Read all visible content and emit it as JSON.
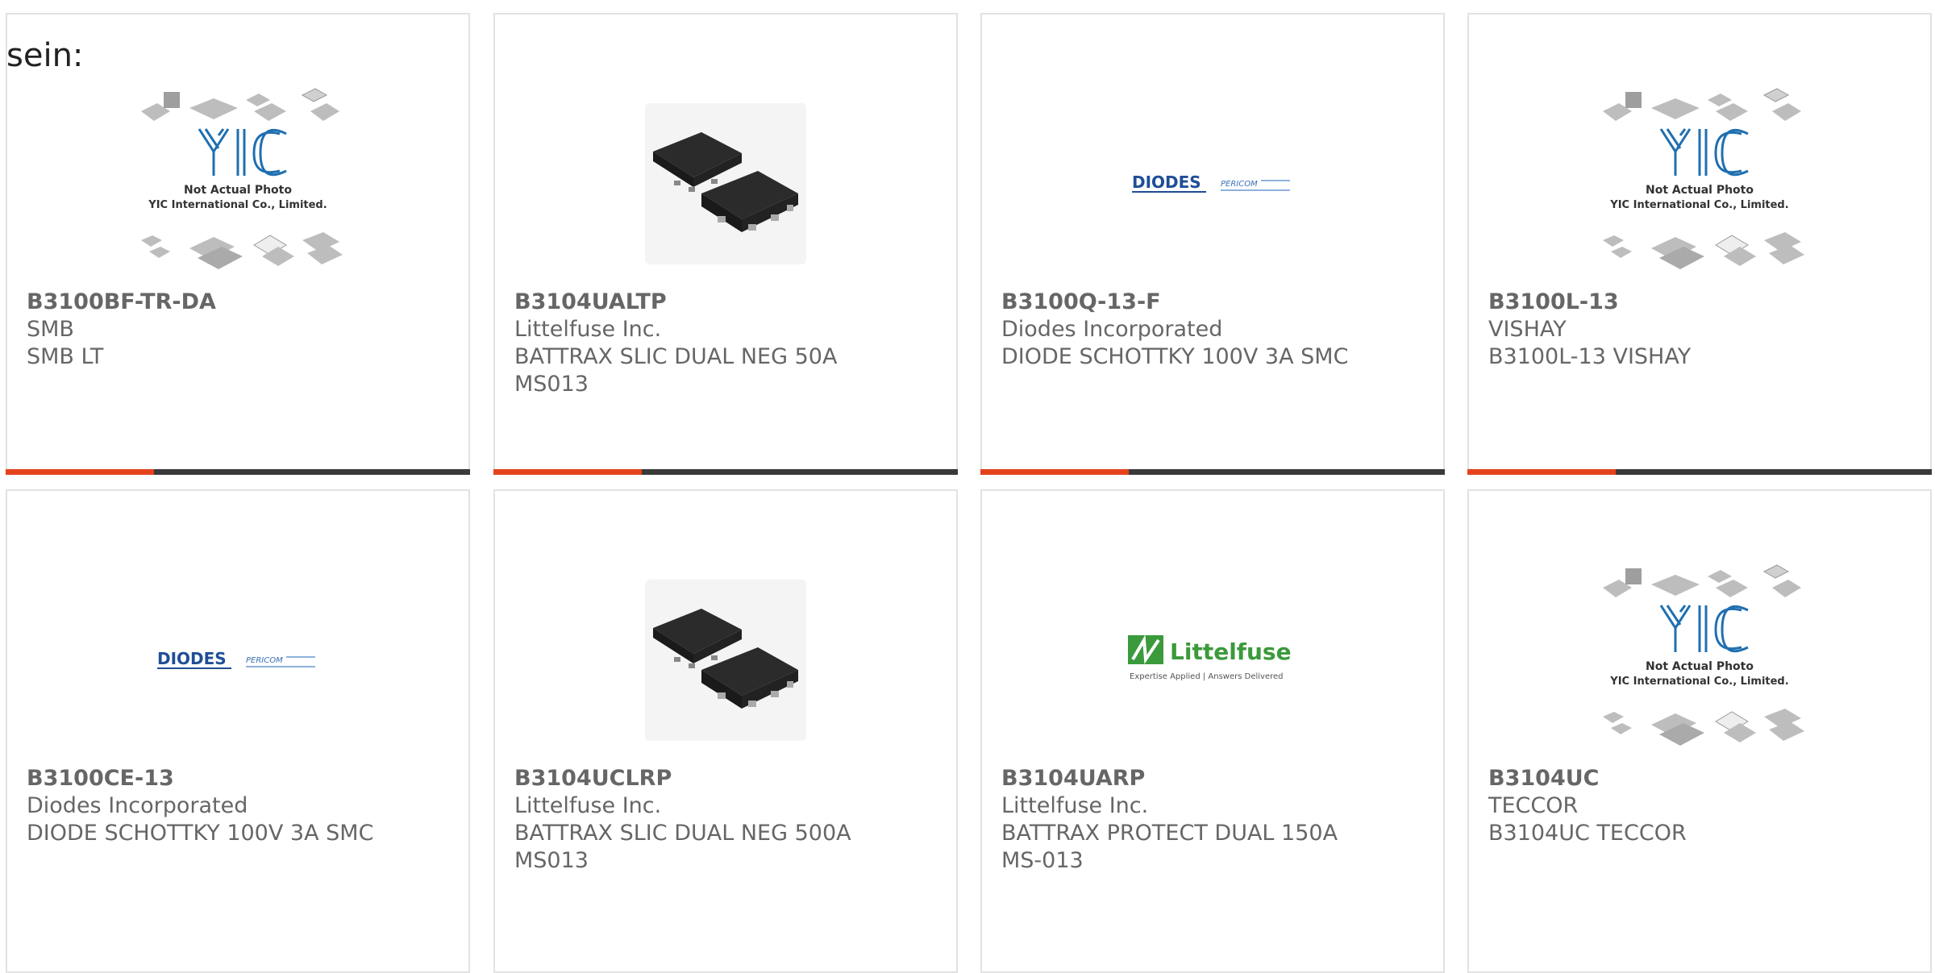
{
  "intro_text": "sein:",
  "yic_photo": {
    "line1": "Not Actual Photo",
    "line2": "YIC International Co., Limited."
  },
  "logos": {
    "diodes": "DIODES",
    "pericom": "PERICOM",
    "littelfuse": "Littelfuse",
    "littelfuse_tagline": "Expertise Applied | Answers Delivered"
  },
  "colors": {
    "accent": "#e4421c",
    "bar": "#3a3a3a",
    "text": "#666666",
    "border": "#e2e2e2"
  },
  "products": [
    {
      "part": "B3100BF-TR-DA",
      "line1": "SMB",
      "line2": "SMB LT",
      "line3": "",
      "image": "yic-placeholder"
    },
    {
      "part": "B3104UALTP",
      "line1": "Littelfuse Inc.",
      "line2": "BATTRAX SLIC DUAL NEG 50A",
      "line3": "MS013",
      "image": "chip-photo"
    },
    {
      "part": "B3100Q-13-F",
      "line1": "Diodes Incorporated",
      "line2": "DIODE SCHOTTKY 100V 3A SMC",
      "line3": "",
      "image": "diodes-logo"
    },
    {
      "part": "B3100L-13",
      "line1": "VISHAY",
      "line2": "B3100L-13 VISHAY",
      "line3": "",
      "image": "yic-placeholder"
    },
    {
      "part": "B3100CE-13",
      "line1": "Diodes Incorporated",
      "line2": "DIODE SCHOTTKY 100V 3A SMC",
      "line3": "",
      "image": "diodes-logo"
    },
    {
      "part": "B3104UCLRP",
      "line1": "Littelfuse Inc.",
      "line2": "BATTRAX SLIC DUAL NEG 500A",
      "line3": "MS013",
      "image": "chip-photo"
    },
    {
      "part": "B3104UARP",
      "line1": "Littelfuse Inc.",
      "line2": "BATTRAX PROTECT DUAL 150A",
      "line3": "MS-013",
      "image": "littelfuse-logo"
    },
    {
      "part": "B3104UC",
      "line1": "TECCOR",
      "line2": "B3104UC TECCOR",
      "line3": "",
      "image": "yic-placeholder"
    }
  ]
}
